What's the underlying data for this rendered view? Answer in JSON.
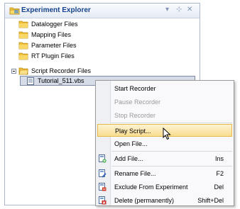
{
  "explorer": {
    "title": "Experiment Explorer",
    "controls": {
      "dropdown": "▾",
      "pin": "⊹",
      "close": "✕"
    },
    "items": [
      {
        "label": "Datalogger Files",
        "icon": "folder-icon"
      },
      {
        "label": "Mapping Files",
        "icon": "folder-icon"
      },
      {
        "label": "Parameter Files",
        "icon": "folder-icon"
      },
      {
        "label": "RT Plugin Files",
        "icon": "folder-icon"
      },
      {
        "label": "Script Recorder Files",
        "icon": "folder-open-icon",
        "expanded": true
      }
    ],
    "selected_child": {
      "label": "Tutorial_511.vbs",
      "icon": "script-file-icon"
    }
  },
  "context_menu": {
    "items": [
      {
        "label": "Start Recorder",
        "enabled": true
      },
      {
        "label": "Pause Recorder",
        "enabled": false
      },
      {
        "label": "Stop Recorder",
        "enabled": false
      },
      {
        "label": "Play Script...",
        "enabled": true,
        "hovered": true
      },
      {
        "label": "Open File...",
        "enabled": true
      },
      {
        "label": "Add File...",
        "shortcut": "Ins",
        "icon": "add-file-icon"
      },
      {
        "label": "Rename File...",
        "shortcut": "F2",
        "icon": "rename-file-icon"
      },
      {
        "label": "Exclude From Experiment",
        "shortcut": "Del",
        "icon": "exclude-file-icon"
      },
      {
        "label": "Delete (permanently)",
        "shortcut": "Shift+Del",
        "icon": "delete-file-icon"
      }
    ]
  },
  "colors": {
    "title_text": "#15428b",
    "hover_fill": "#f9dd8f",
    "selection_fill": "#d6dde8"
  }
}
